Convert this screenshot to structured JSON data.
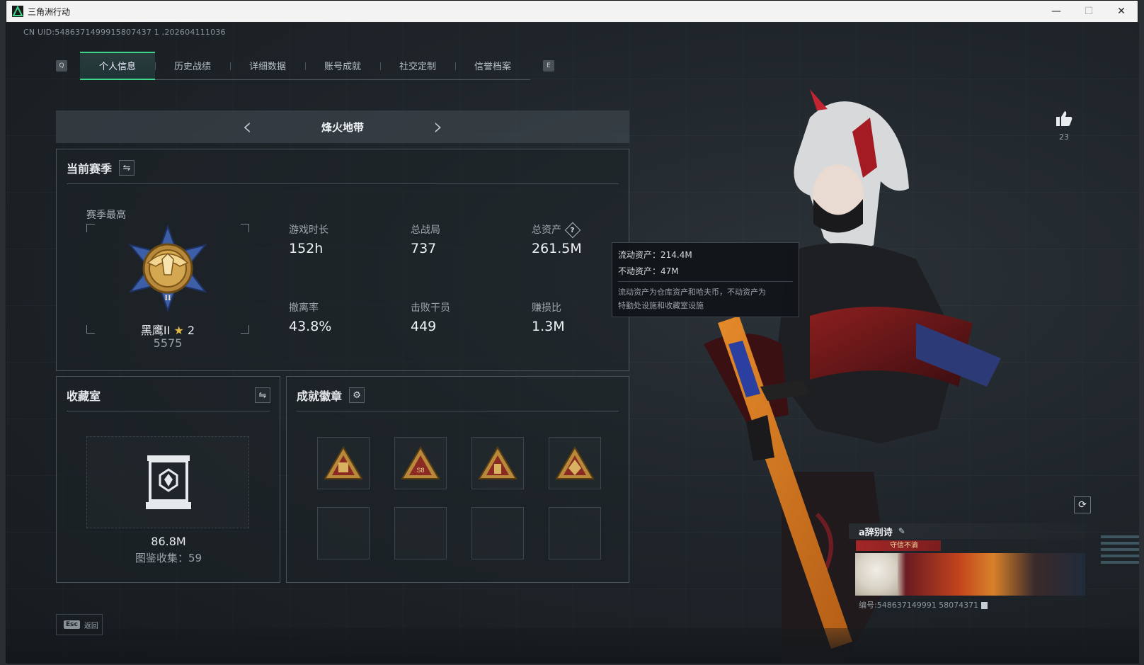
{
  "window": {
    "title": "三角洲行动",
    "controls": {
      "minimize": "—",
      "maximize": "☐",
      "close": "✕"
    }
  },
  "uid_text": "CN UID:5486371499915807437 1 ,202604111036",
  "tabs": {
    "prev_key": "Q",
    "next_key": "E",
    "items": [
      {
        "label": "个人信息",
        "active": true
      },
      {
        "label": "历史战绩",
        "active": false
      },
      {
        "label": "详细数据",
        "active": false
      },
      {
        "label": "账号成就",
        "active": false
      },
      {
        "label": "社交定制",
        "active": false
      },
      {
        "label": "信誉档案",
        "active": false
      }
    ]
  },
  "mode": {
    "title": "烽火地带",
    "prev": "‹",
    "next": "›"
  },
  "season_panel": {
    "title": "当前赛季",
    "swap_icon": "⇋",
    "season_best_label": "赛季最高",
    "rank_name": "黑鹰II",
    "rank_stars": "2",
    "rank_score": "5575",
    "stats": [
      {
        "label": "游戏时长",
        "value": "152h"
      },
      {
        "label": "总战局",
        "value": "737"
      },
      {
        "label": "总资产",
        "value": "261.5M",
        "help": "?"
      },
      {
        "label": "撤离率",
        "value": "43.8%"
      },
      {
        "label": "击败干员",
        "value": "449"
      },
      {
        "label": "赚损比",
        "value": "1.3M"
      }
    ]
  },
  "tooltip": {
    "liquid": "流动资产：214.4M",
    "fixed": "不动资产：47M",
    "note_line1": "流动资产为仓库资产和哈夫币，不动资产为",
    "note_line2": "特勤处设施和收藏室设施"
  },
  "collection_panel": {
    "title": "收藏室",
    "swap_icon": "⇋",
    "value": "86.8M",
    "count_text": "图鉴收集：59"
  },
  "badges_panel": {
    "title": "成就徽章",
    "gear_icon": "⚙",
    "badges": [
      "badge-1",
      "badge-2",
      "badge-3",
      "badge-4"
    ],
    "empty_slots": 4
  },
  "profile": {
    "likes": "23",
    "nickname": "a辞别诗",
    "title_tag": "守信不渝",
    "player_id": "编号:548637149991 58074371"
  },
  "footer": {
    "esc_key": "Esc",
    "esc_label": "返回"
  },
  "colors": {
    "accent": "#3ed58a",
    "panel_border": "#4a535a",
    "gold": "#c9a24a"
  }
}
